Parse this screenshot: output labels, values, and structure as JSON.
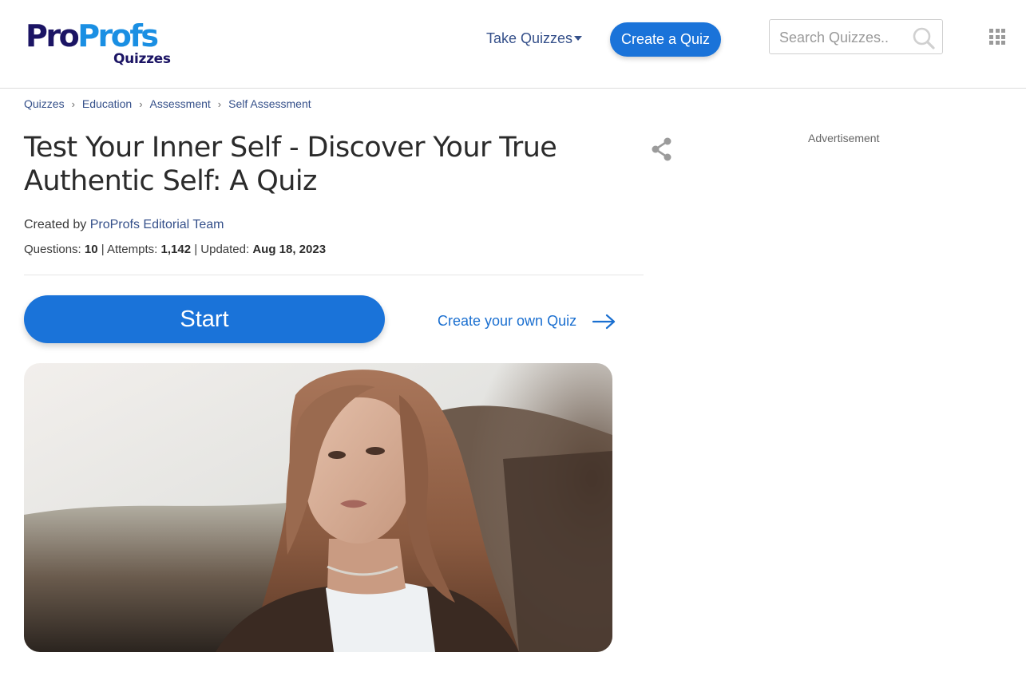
{
  "header": {
    "logo": {
      "main_pro": "Pro",
      "main_profs": "Profs",
      "sub": "Quizzes"
    },
    "nav": {
      "take_quizzes": "Take Quizzes",
      "take_quizzes_icon": "caret-down-icon"
    },
    "create_quiz_label": "Create a Quiz",
    "search": {
      "placeholder": "Search Quizzes..",
      "value": "",
      "icon": "search-icon"
    },
    "apps_icon": "apps-grid-icon"
  },
  "breadcrumb": {
    "items": [
      "Quizzes",
      "Education",
      "Assessment",
      "Self Assessment"
    ],
    "separator": "›"
  },
  "quiz": {
    "title": "Test Your Inner Self - Discover Your True Authentic Self: A Quiz",
    "created_by_prefix": "Created by ",
    "author": "ProProfs Editorial Team",
    "questions_label": "Questions: ",
    "questions": "10",
    "attempts_label": " | Attempts: ",
    "attempts": "1,142",
    "updated_label": " | Updated: ",
    "updated": "Aug 18, 2023",
    "share_icon": "share-icon"
  },
  "actions": {
    "start_label": "Start",
    "create_own_label": "Create your own Quiz",
    "create_own_icon": "arrow-right-icon"
  },
  "sidebar": {
    "advertisement_label": "Advertisement"
  },
  "colors": {
    "brand_dark": "#1b1464",
    "brand_light": "#1a8fe3",
    "primary_button": "#1a73d9",
    "link": "#35508a"
  }
}
